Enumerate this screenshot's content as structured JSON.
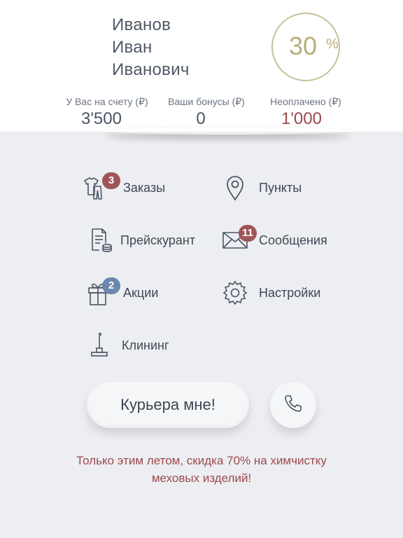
{
  "profile": {
    "last_name": "Иванов",
    "first_name": "Иван",
    "middle_name": "Иванович",
    "discount_value": "30",
    "discount_sign": "%"
  },
  "stats": [
    {
      "label": "У Вас на счету (₽)",
      "value": "3'500"
    },
    {
      "label": "Ваши бонусы (₽)",
      "value": "0"
    },
    {
      "label": "Неоплачено (₽)",
      "value": "1'000"
    }
  ],
  "menu": {
    "orders": {
      "label": "Заказы",
      "badge": "3"
    },
    "points": {
      "label": "Пункты"
    },
    "pricelist": {
      "label": "Прейскурант"
    },
    "messages": {
      "label": "Сообщения",
      "badge": "11"
    },
    "promotions": {
      "label": "Акции",
      "badge": "2"
    },
    "settings": {
      "label": "Настройки"
    },
    "cleaning": {
      "label": "Клининг"
    }
  },
  "actions": {
    "courier_label": "Курьера мне!",
    "phone_icon": "phone-icon"
  },
  "promo": {
    "line1": "Только этим летом, скидка 70% на химчистку",
    "line2": "меховых изделий!"
  },
  "colors": {
    "accent_gold": "#b9ae7a",
    "accent_red": "#9c4a4f",
    "badge_red": "#a0555a",
    "badge_blue": "#6c87ad",
    "background": "#eceef1"
  }
}
